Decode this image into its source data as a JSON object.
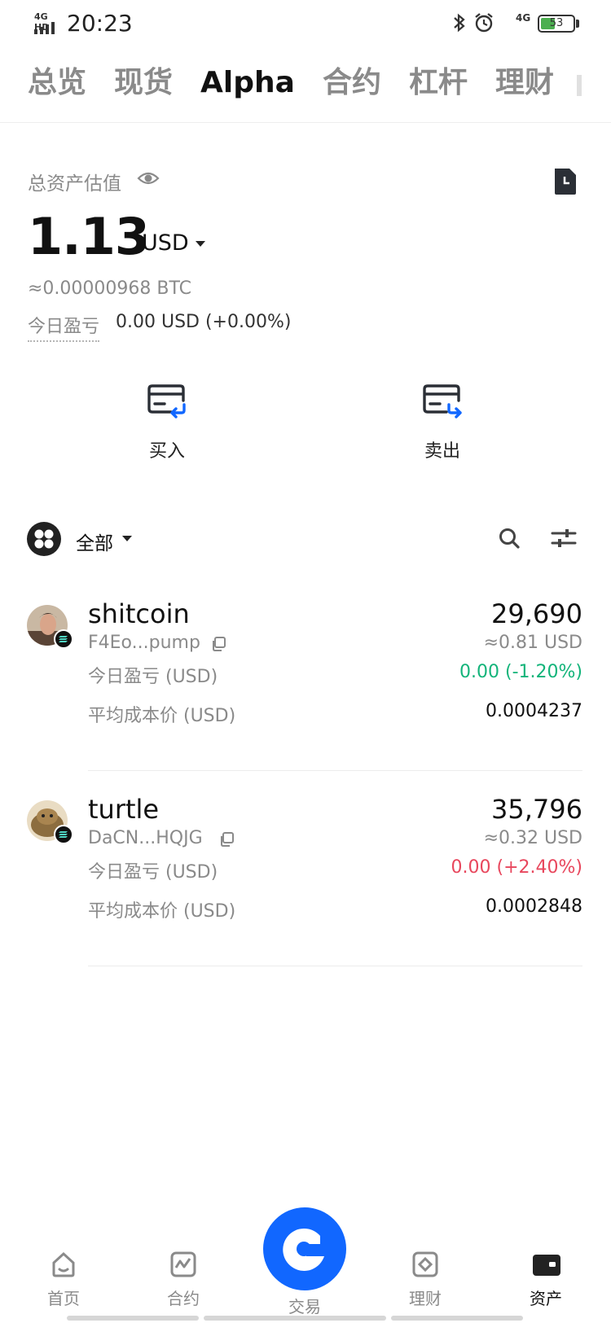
{
  "status_bar": {
    "network_top": "4G HD",
    "time": "20:23",
    "network_right": "4G",
    "battery": "53",
    "battery_level_percent": 53
  },
  "tabs": [
    {
      "label": "总览",
      "active": false
    },
    {
      "label": "现货",
      "active": false
    },
    {
      "label": "Alpha",
      "active": true
    },
    {
      "label": "合约",
      "active": false
    },
    {
      "label": "杠杆",
      "active": false
    },
    {
      "label": "理财",
      "active": false
    }
  ],
  "summary": {
    "total_label": "总资产估值",
    "amount": "1.13",
    "currency": "USD",
    "btc_value": "≈0.00000968 BTC",
    "pnl_label": "今日盈亏",
    "pnl_value": "0.00 USD (+0.00%)"
  },
  "actions": {
    "buy": "买入",
    "sell": "卖出"
  },
  "filter": {
    "all_label": "全部"
  },
  "assets": [
    {
      "name": "shitcoin",
      "address": "F4Eo...pump",
      "quantity": "29,690",
      "usd_value": "≈0.81 USD",
      "pnl_label": "今日盈亏 (USD)",
      "pnl_value": "0.00 (-1.20%)",
      "avg_cost_label": "平均成本价 (USD)",
      "avg_cost": "0.0004237"
    },
    {
      "name": "turtle",
      "address": "DaCN...HQJG",
      "quantity": "35,796",
      "usd_value": "≈0.32 USD",
      "pnl_label": "今日盈亏 (USD)",
      "pnl_value": "0.00 (+2.40%)",
      "avg_cost_label": "平均成本价 (USD)",
      "avg_cost": "0.0002848"
    }
  ],
  "colors": {
    "accent": "#1167ff",
    "positive": "#13b47a",
    "negative": "#e8475d"
  },
  "bottom_nav": {
    "home": "首页",
    "futures": "合约",
    "trade": "交易",
    "earn": "理财",
    "assets": "资产"
  }
}
